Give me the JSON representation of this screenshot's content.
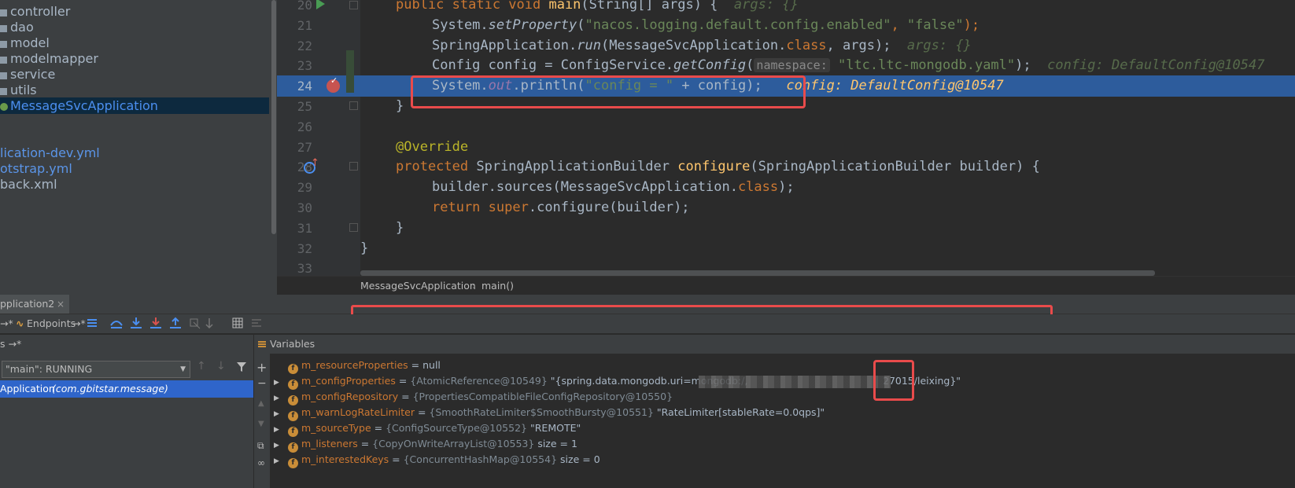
{
  "tree": {
    "items": [
      {
        "label": "controller",
        "kind": "folder"
      },
      {
        "label": "dao",
        "kind": "folder"
      },
      {
        "label": "model",
        "kind": "folder"
      },
      {
        "label": "modelmapper",
        "kind": "folder"
      },
      {
        "label": "service",
        "kind": "folder"
      },
      {
        "label": "utils",
        "kind": "folder"
      },
      {
        "label": "MessageSvcApplication",
        "kind": "class",
        "selected": true
      },
      {
        "label": "lication-dev.yml",
        "kind": "file"
      },
      {
        "label": "otstrap.yml",
        "kind": "file"
      },
      {
        "label": "back.xml",
        "kind": "file"
      }
    ]
  },
  "editor": {
    "line_numbers": [
      "20",
      "21",
      "22",
      "23",
      "24",
      "25",
      "26",
      "27",
      "28",
      "29",
      "30",
      "31",
      "32",
      "33"
    ],
    "lines": {
      "l20": {
        "kw1": "public static void ",
        "fn": "main",
        "rest": "(String[] args) {",
        "hint": "  args: {}"
      },
      "l21": {
        "a": "System.",
        "fn": "setProperty",
        "b": "(",
        "s1": "\"nacos.logging.default.config.enabled\"",
        "c": ", ",
        "s2": "\"false\"",
        "d": ");"
      },
      "l22": {
        "a": "SpringApplication.",
        "fn": "run",
        "b": "(MessageSvcApplication.",
        "kw": "class",
        "c": ", args);",
        "hint": "  args: {}"
      },
      "l23": {
        "a": "Config config = ConfigService.",
        "fn": "getConfig",
        "b": "(",
        "ph": "namespace:",
        "s1": " \"ltc.ltc-mongodb.yaml\"",
        "c": ");",
        "hint": "  config: DefaultConfig@10547"
      },
      "l24": {
        "a": "System.",
        "fld": "out",
        "b": ".println(",
        "s1": "\"config = \"",
        "c": " + config);",
        "val": "   config: DefaultConfig@10547"
      },
      "l25": {
        "a": "}"
      },
      "l27": {
        "ann": "@Override"
      },
      "l28": {
        "kw": "protected ",
        "a": "SpringApplicationBuilder ",
        "fn": "configure",
        "b": "(SpringApplicationBuilder builder) {"
      },
      "l29": {
        "a": "builder.sources(MessageSvcApplication.",
        "kw": "class",
        "b": ");"
      },
      "l30": {
        "kw": "return ",
        "kw2": "super",
        "a": ".configure(builder);"
      },
      "l31": {
        "a": "}"
      },
      "l32": {
        "a": "}"
      }
    },
    "breadcrumb": {
      "cls": "MessageSvcApplication",
      "sep": "›",
      "method": "main()"
    }
  },
  "debug": {
    "tab_label": "pplication2",
    "tab_close": "×",
    "endpoints_label": "Endpoints",
    "frames_header": "s →*",
    "thread_value": "\"main\": RUNNING",
    "frame_selected": "Application",
    "frame_pkg": "(com.gbitstar.message)",
    "vars_title": "Variables",
    "variables": [
      {
        "name": "m_resourceProperties",
        "eq": " = ",
        "type": "",
        "value": "null",
        "expandable": false
      },
      {
        "name": "m_configProperties",
        "eq": " = ",
        "type": "{AtomicReference@10549} ",
        "value": "\"{spring.data.mongodb.uri=mongodb:/,",
        "tail": "27015/leixing}\"",
        "expandable": true
      },
      {
        "name": "m_configRepository",
        "eq": " = ",
        "type": "{PropertiesCompatibleFileConfigRepository@10550}",
        "value": "",
        "expandable": true
      },
      {
        "name": "m_warnLogRateLimiter",
        "eq": " = ",
        "type": "{SmoothRateLimiter$SmoothBursty@10551} ",
        "value": "\"RateLimiter[stableRate=0.0qps]\"",
        "expandable": true
      },
      {
        "name": "m_sourceType",
        "eq": " = ",
        "type": "{ConfigSourceType@10552} ",
        "value": "\"REMOTE\"",
        "expandable": true
      },
      {
        "name": "m_listeners",
        "eq": " = ",
        "type": "{CopyOnWriteArrayList@10553} ",
        "value": " size = 1",
        "expandable": true
      },
      {
        "name": "m_interestedKeys",
        "eq": " = ",
        "type": "{ConcurrentHashMap@10554} ",
        "value": " size = 0",
        "expandable": true
      }
    ]
  }
}
